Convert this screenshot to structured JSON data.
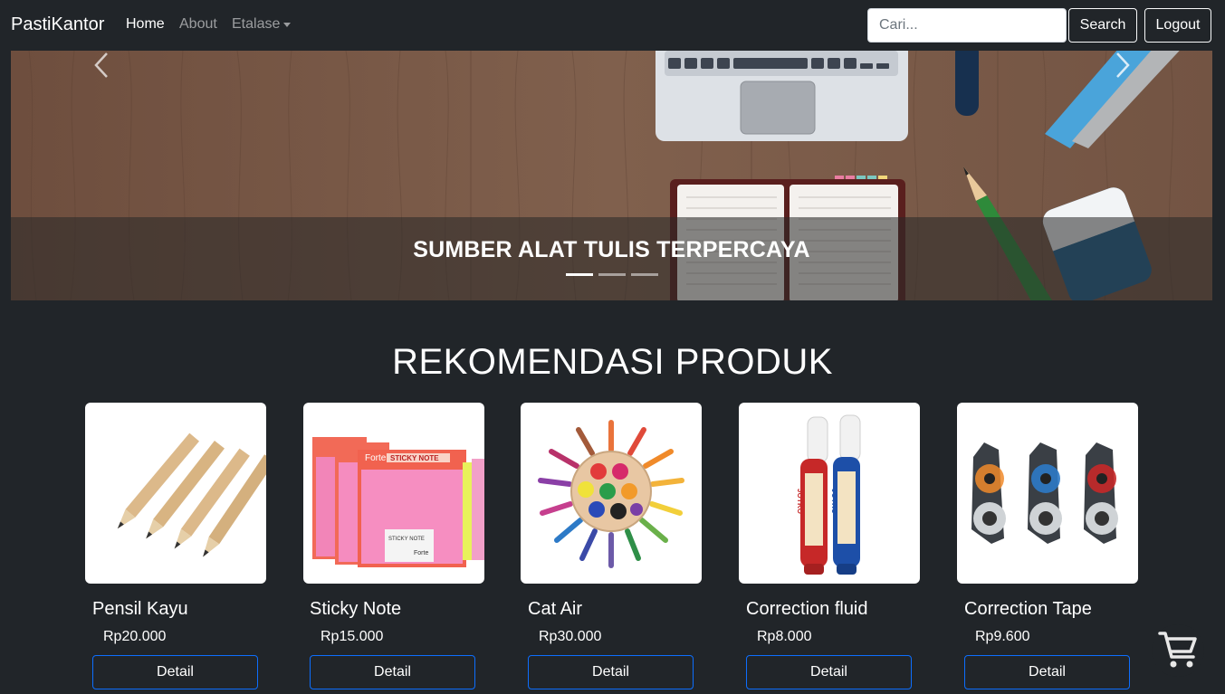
{
  "navbar": {
    "brand": "PastiKantor",
    "links": [
      {
        "label": "Home"
      },
      {
        "label": "About"
      },
      {
        "label": "Etalase"
      }
    ],
    "search": {
      "placeholder": "Cari...",
      "button_label": "Search"
    },
    "logout_label": "Logout"
  },
  "carousel": {
    "caption": "SUMBER ALAT TULIS TERPERCAYA",
    "slide_count": 3,
    "active_index": 0
  },
  "section": {
    "title": "REKOMENDASI PRODUK"
  },
  "products": [
    {
      "name": "Pensil Kayu",
      "price": "Rp20.000",
      "button_label": "Detail",
      "image_icon": "wooden-pencils-icon"
    },
    {
      "name": "Sticky Note",
      "price": "Rp15.000",
      "button_label": "Detail",
      "image_icon": "sticky-note-pack-icon"
    },
    {
      "name": "Cat Air",
      "price": "Rp30.000",
      "button_label": "Detail",
      "image_icon": "watercolor-palette-icon"
    },
    {
      "name": "Correction fluid",
      "price": "Rp8.000",
      "button_label": "Detail",
      "image_icon": "correction-pen-icon"
    },
    {
      "name": "Correction Tape",
      "price": "Rp9.600",
      "button_label": "Detail",
      "image_icon": "correction-tape-icon"
    }
  ],
  "colors": {
    "background": "#212529",
    "detail_button_border": "#0d6efd",
    "wood": "#7b5a48"
  }
}
